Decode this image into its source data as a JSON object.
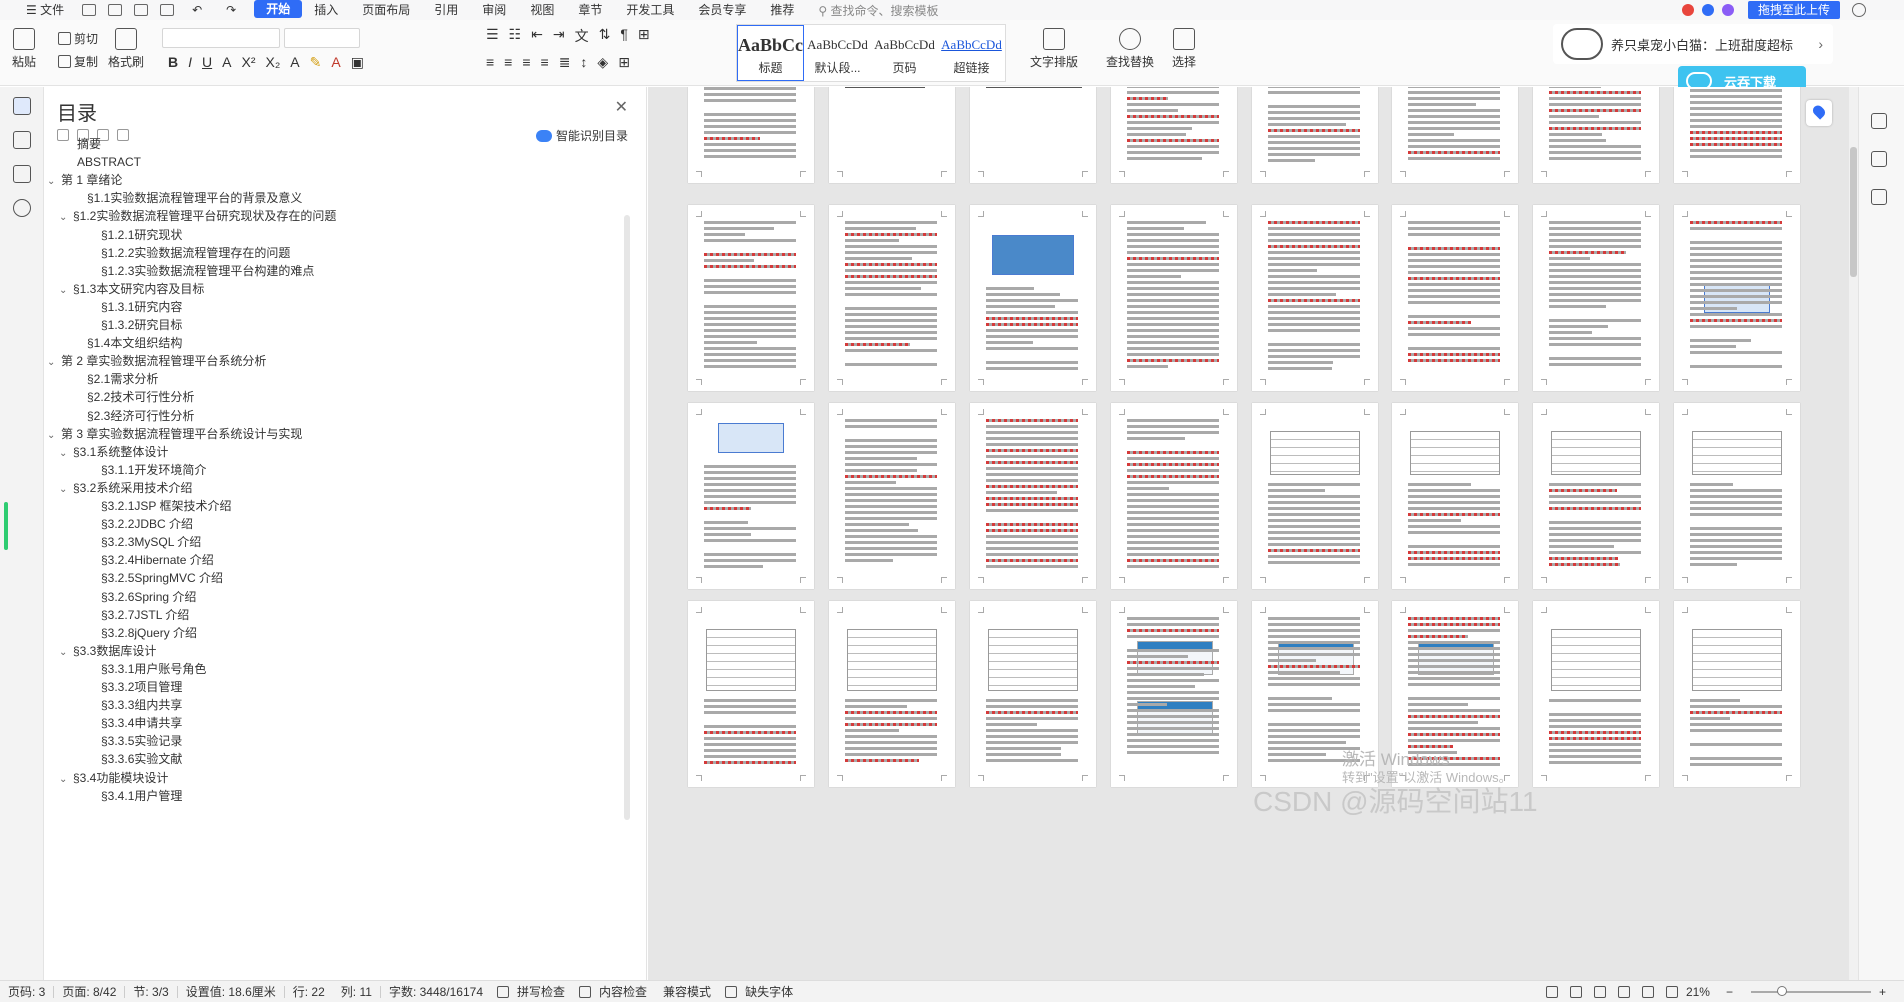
{
  "menubar": {
    "file": "文件",
    "tabs": [
      "开始",
      "插入",
      "页面布局",
      "引用",
      "审阅",
      "视图",
      "章节",
      "开发工具",
      "会员专享",
      "推荐"
    ],
    "active_tab": "开始",
    "search": "查找命令、搜索模板",
    "share": "拖拽至此上传"
  },
  "ribbon": {
    "paste": "粘贴",
    "cut": "剪切",
    "copy": "复制",
    "format_painter": "格式刷",
    "styles": [
      {
        "sample": "AaBbCc",
        "name": "标题"
      },
      {
        "sample": "AaBbCcDd",
        "name": "默认段..."
      },
      {
        "sample": "AaBbCcDd",
        "name": "页码"
      },
      {
        "sample": "AaBbCcDd",
        "name": "超链接"
      }
    ],
    "text_layout": "文字排版",
    "find_replace": "查找替换",
    "select": "选择"
  },
  "notice": {
    "text": "养只桌宠小白猫：上班甜度超标",
    "cloud_download": "云吞下载"
  },
  "toc": {
    "title": "目录",
    "smart_button": "智能识别目录",
    "items": [
      {
        "label": "摘要",
        "level": 0,
        "arrow": ""
      },
      {
        "label": "ABSTRACT",
        "level": 0,
        "arrow": ""
      },
      {
        "label": "第 1 章绪论",
        "level": 0,
        "arrow": "v"
      },
      {
        "label": "§1.1实验数据流程管理平台的背景及意义",
        "level": 1,
        "arrow": ""
      },
      {
        "label": "§1.2实验数据流程管理平台研究现状及存在的问题",
        "level": 1,
        "arrow": "v"
      },
      {
        "label": "§1.2.1研究现状",
        "level": 2,
        "arrow": ""
      },
      {
        "label": "§1.2.2实验数据流程管理存在的问题",
        "level": 2,
        "arrow": ""
      },
      {
        "label": "§1.2.3实验数据流程管理平台构建的难点",
        "level": 2,
        "arrow": ""
      },
      {
        "label": "§1.3本文研究内容及目标",
        "level": 1,
        "arrow": "v"
      },
      {
        "label": "§1.3.1研究内容",
        "level": 2,
        "arrow": ""
      },
      {
        "label": "§1.3.2研究目标",
        "level": 2,
        "arrow": ""
      },
      {
        "label": "§1.4本文组织结构",
        "level": 1,
        "arrow": ""
      },
      {
        "label": "第 2 章实验数据流程管理平台系统分析",
        "level": 0,
        "arrow": "v"
      },
      {
        "label": "§2.1需求分析",
        "level": 1,
        "arrow": ""
      },
      {
        "label": "§2.2技术可行性分析",
        "level": 1,
        "arrow": ""
      },
      {
        "label": "§2.3经济可行性分析",
        "level": 1,
        "arrow": ""
      },
      {
        "label": "第 3 章实验数据流程管理平台系统设计与实现",
        "level": 0,
        "arrow": "v"
      },
      {
        "label": "§3.1系统整体设计",
        "level": 1,
        "arrow": "v"
      },
      {
        "label": "§3.1.1开发环境简介",
        "level": 2,
        "arrow": ""
      },
      {
        "label": "§3.2系统采用技术介绍",
        "level": 1,
        "arrow": "v"
      },
      {
        "label": "§3.2.1JSP 框架技术介绍",
        "level": 2,
        "arrow": ""
      },
      {
        "label": "§3.2.2JDBC 介绍",
        "level": 2,
        "arrow": ""
      },
      {
        "label": "§3.2.3MySQL 介绍",
        "level": 2,
        "arrow": ""
      },
      {
        "label": "§3.2.4Hibernate 介绍",
        "level": 2,
        "arrow": ""
      },
      {
        "label": "§3.2.5SpringMVC 介绍",
        "level": 2,
        "arrow": ""
      },
      {
        "label": "§3.2.6Spring 介绍",
        "level": 2,
        "arrow": ""
      },
      {
        "label": "§3.2.7JSTL 介绍",
        "level": 2,
        "arrow": ""
      },
      {
        "label": "§3.2.8jQuery 介绍",
        "level": 2,
        "arrow": ""
      },
      {
        "label": "§3.3数据库设计",
        "level": 1,
        "arrow": "v"
      },
      {
        "label": "§3.3.1用户账号角色",
        "level": 2,
        "arrow": ""
      },
      {
        "label": "§3.3.2项目管理",
        "level": 2,
        "arrow": ""
      },
      {
        "label": "§3.3.3组内共享",
        "level": 2,
        "arrow": ""
      },
      {
        "label": "§3.3.4申请共享",
        "level": 2,
        "arrow": ""
      },
      {
        "label": "§3.3.5实验记录",
        "level": 2,
        "arrow": ""
      },
      {
        "label": "§3.3.6实验文献",
        "level": 2,
        "arrow": ""
      },
      {
        "label": "§3.4功能模块设计",
        "level": 1,
        "arrow": "v"
      },
      {
        "label": "§3.4.1用户管理",
        "level": 2,
        "arrow": ""
      }
    ]
  },
  "watermark": {
    "activate_title": "激活 Windows",
    "activate_sub": "转到\"设置\"以激活 Windows。",
    "csdn": "CSDN @源码空间站11"
  },
  "statusbar": {
    "page_no": "页码: 3",
    "page": "页面: 8/42",
    "section": "节: 3/3",
    "setting": "设置值: 18.6厘米",
    "row": "行: 22",
    "col": "列: 11",
    "words": "字数: 3448/16174",
    "spell": "拼写检查",
    "content_check": "内容检查",
    "compat": "兼容模式",
    "missing_font": "缺失字体",
    "zoom": "21%"
  }
}
